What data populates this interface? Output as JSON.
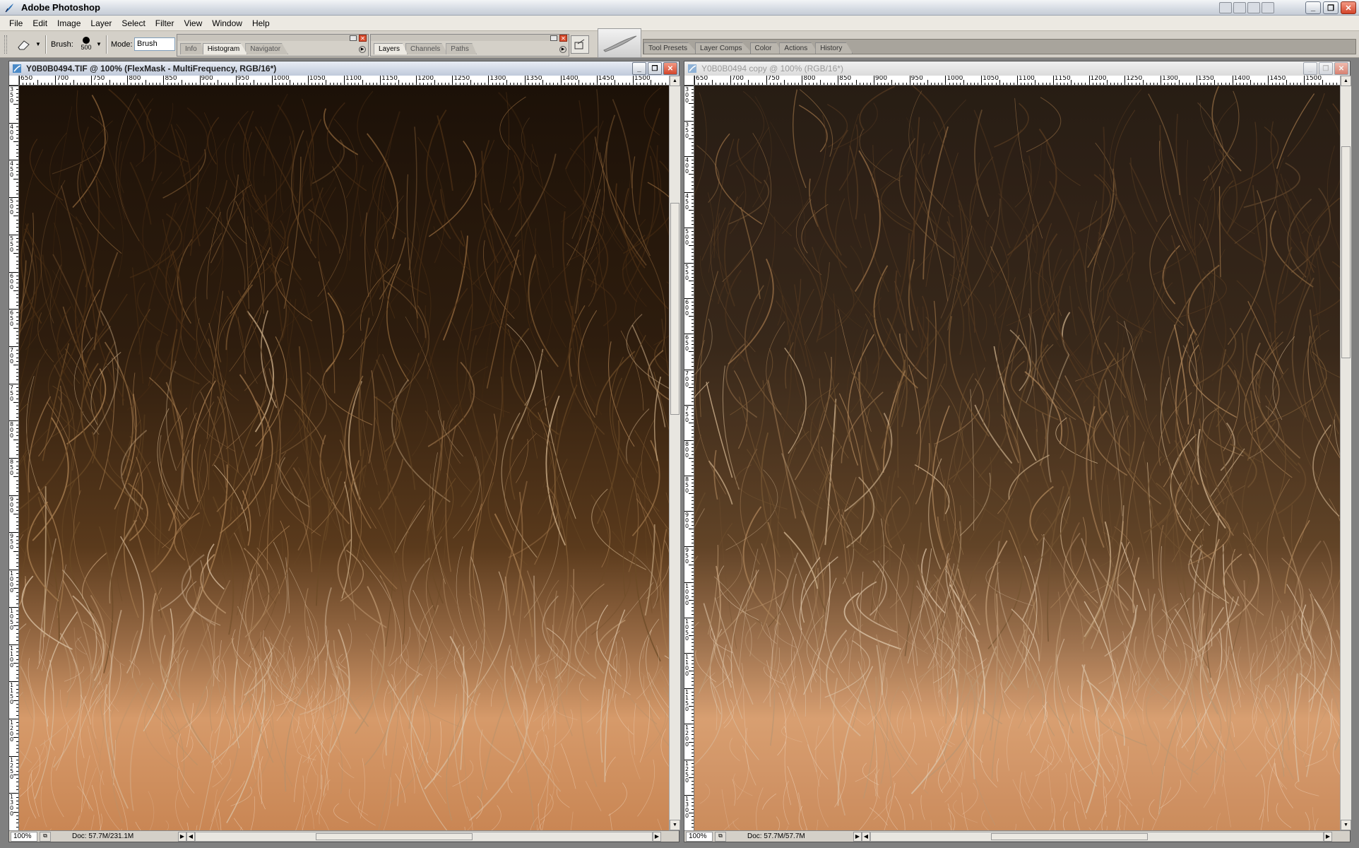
{
  "app": {
    "title": "Adobe Photoshop",
    "minimize": "_",
    "restore": "❐",
    "close": "✕"
  },
  "menu": [
    "File",
    "Edit",
    "Image",
    "Layer",
    "Select",
    "Filter",
    "View",
    "Window",
    "Help"
  ],
  "options": {
    "brush_label": "Brush:",
    "brush_size": "500",
    "mode_label": "Mode:",
    "mode_value": "Brush"
  },
  "palette1": {
    "tabs": [
      "Info",
      "Histogram",
      "Navigator"
    ],
    "active": "Histogram"
  },
  "palette2": {
    "tabs": [
      "Layers",
      "Channels",
      "Paths"
    ],
    "active": "Layers"
  },
  "palette_well": {
    "tabs": [
      "Tool Presets",
      "Layer Comps",
      "Color",
      "Actions",
      "History"
    ]
  },
  "doc1": {
    "title": "Y0B0B0494.TIF @ 100% (FlexMask - MultiFrequency, RGB/16*)",
    "zoom": "100%",
    "info": "Doc: 57.7M/231.1M",
    "hruler": [
      "650",
      "700",
      "750",
      "800",
      "850",
      "900",
      "950",
      "1000",
      "1050",
      "1100",
      "1150",
      "1200",
      "1250",
      "1300",
      "1350",
      "1400",
      "1450",
      "1500"
    ],
    "vruler": [
      "350",
      "400",
      "450",
      "500",
      "550",
      "600",
      "650",
      "700",
      "750",
      "800",
      "850",
      "900",
      "950",
      "1000",
      "1050",
      "1100",
      "1150",
      "1200",
      "1250",
      "1300"
    ],
    "state": "active"
  },
  "doc2": {
    "title": "Y0B0B0494 copy @ 100% (RGB/16*)",
    "zoom": "100%",
    "info": "Doc: 57.7M/57.7M",
    "hruler": [
      "650",
      "700",
      "750",
      "800",
      "850",
      "900",
      "950",
      "1000",
      "1050",
      "1100",
      "1150",
      "1200",
      "1250",
      "1300",
      "1350",
      "1400",
      "1450",
      "1500"
    ],
    "vruler": [
      "300",
      "350",
      "400",
      "450",
      "500",
      "550",
      "600",
      "650",
      "700",
      "750",
      "800",
      "850",
      "900",
      "950",
      "1000",
      "1050",
      "1100",
      "1150",
      "1200",
      "1250",
      "1300"
    ],
    "state": "inactive"
  },
  "icons": {
    "app_logo": "photoshop-feather-icon",
    "tool": "eraser-icon",
    "doc_icon": "document-icon"
  },
  "colors": {
    "hair_dark": "#1c1108",
    "hair_mid": "#5a3a1c",
    "hair_light": "#b49068",
    "skin": "#c98654",
    "skin_light": "#d69a6a"
  }
}
